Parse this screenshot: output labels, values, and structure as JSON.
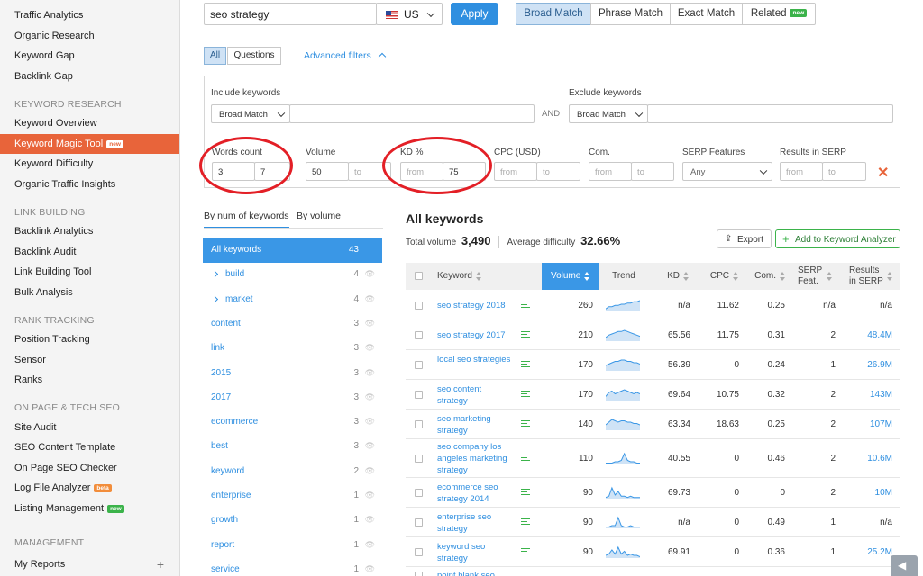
{
  "sidebar": {
    "items": [
      {
        "label": "Traffic Analytics"
      },
      {
        "label": "Organic Research"
      },
      {
        "label": "Keyword Gap"
      },
      {
        "label": "Backlink Gap"
      },
      {
        "section": "KEYWORD RESEARCH"
      },
      {
        "label": "Keyword Overview"
      },
      {
        "label": "Keyword Magic Tool",
        "badge": "new",
        "active": true
      },
      {
        "label": "Keyword Difficulty"
      },
      {
        "label": "Organic Traffic Insights"
      },
      {
        "section": "LINK BUILDING"
      },
      {
        "label": "Backlink Analytics"
      },
      {
        "label": "Backlink Audit"
      },
      {
        "label": "Link Building Tool"
      },
      {
        "label": "Bulk Analysis"
      },
      {
        "section": "RANK TRACKING"
      },
      {
        "label": "Position Tracking"
      },
      {
        "label": "Sensor"
      },
      {
        "label": "Ranks"
      },
      {
        "section": "ON PAGE & TECH SEO"
      },
      {
        "label": "Site Audit"
      },
      {
        "label": "SEO Content Template"
      },
      {
        "label": "On Page SEO Checker"
      },
      {
        "label": "Log File Analyzer",
        "badge": "beta"
      },
      {
        "label": "Listing Management",
        "badge": "new"
      },
      {
        "section": "MANAGEMENT"
      },
      {
        "label": "My Reports",
        "plus": "+"
      }
    ]
  },
  "search": {
    "value": "seo strategy",
    "country": "US",
    "apply": "Apply"
  },
  "match_tabs": [
    "Broad Match",
    "Phrase Match",
    "Exact Match",
    "Related"
  ],
  "related_badge": "new",
  "filter_tabs": {
    "all": "All",
    "questions": "Questions",
    "advanced": "Advanced filters"
  },
  "include": {
    "label": "Include keywords",
    "match": "Broad Match"
  },
  "and": "AND",
  "exclude": {
    "label": "Exclude keywords",
    "match": "Broad Match"
  },
  "filters": {
    "words": {
      "label": "Words count",
      "from": "3",
      "to": "7"
    },
    "volume": {
      "label": "Volume",
      "from": "50",
      "to_ph": "to"
    },
    "kd": {
      "label": "KD %",
      "from_ph": "from",
      "to": "75"
    },
    "cpc": {
      "label": "CPC (USD)",
      "from_ph": "from",
      "to_ph": "to"
    },
    "com": {
      "label": "Com.",
      "from_ph": "from",
      "to_ph": "to"
    },
    "serp": {
      "label": "SERP Features",
      "value": "Any"
    },
    "results": {
      "label": "Results in SERP",
      "from_ph": "from",
      "to_ph": "to"
    }
  },
  "group_tabs": {
    "by_num": "By num of keywords",
    "by_volume": "By volume"
  },
  "groups": [
    {
      "name": "All keywords",
      "count": "43",
      "active": true
    },
    {
      "name": "build",
      "count": "4",
      "expand": true
    },
    {
      "name": "market",
      "count": "4",
      "expand": true
    },
    {
      "name": "content",
      "count": "3"
    },
    {
      "name": "link",
      "count": "3"
    },
    {
      "name": "2015",
      "count": "3"
    },
    {
      "name": "2017",
      "count": "3"
    },
    {
      "name": "ecommerce",
      "count": "3"
    },
    {
      "name": "best",
      "count": "3"
    },
    {
      "name": "keyword",
      "count": "2"
    },
    {
      "name": "enterprise",
      "count": "1"
    },
    {
      "name": "growth",
      "count": "1"
    },
    {
      "name": "report",
      "count": "1"
    },
    {
      "name": "service",
      "count": "1"
    }
  ],
  "results": {
    "title": "All keywords",
    "total_label": "Total volume",
    "total_value": "3,490",
    "avg_label": "Average difficulty",
    "avg_value": "32.66%",
    "export": "Export",
    "add": "Add to Keyword Analyzer"
  },
  "columns": {
    "keyword": "Keyword",
    "volume": "Volume",
    "trend": "Trend",
    "kd": "KD",
    "cpc": "CPC",
    "com": "Com.",
    "serp": "SERP Feat.",
    "results": "Results in SERP"
  },
  "rows": [
    {
      "kw": "seo strategy 2018",
      "vol": "260",
      "kd": "n/a",
      "cpc": "11.62",
      "com": "0.25",
      "serp": "n/a",
      "res": "n/a",
      "trend": [
        2,
        4,
        4,
        5,
        5,
        6,
        6,
        7,
        7,
        8,
        8,
        9
      ]
    },
    {
      "kw": "seo strategy 2017",
      "vol": "210",
      "kd": "65.56",
      "cpc": "11.75",
      "com": "0.31",
      "serp": "2",
      "res": "48.4M",
      "trend": [
        3,
        5,
        6,
        7,
        8,
        8,
        9,
        8,
        7,
        6,
        5,
        4
      ]
    },
    {
      "kw": "local seo strategies",
      "vol": "170",
      "kd": "56.39",
      "cpc": "0",
      "com": "0.24",
      "serp": "1",
      "res": "26.9M",
      "trend": [
        4,
        5,
        6,
        7,
        7,
        8,
        8,
        7,
        7,
        6,
        6,
        5
      ]
    },
    {
      "kw": "seo content strategy",
      "vol": "170",
      "kd": "69.64",
      "cpc": "10.75",
      "com": "0.32",
      "serp": "2",
      "res": "143M",
      "trend": [
        3,
        6,
        7,
        5,
        6,
        7,
        8,
        7,
        6,
        5,
        6,
        5
      ]
    },
    {
      "kw": "seo marketing strategy",
      "vol": "140",
      "kd": "63.34",
      "cpc": "18.63",
      "com": "0.25",
      "serp": "2",
      "res": "107M",
      "trend": [
        4,
        6,
        8,
        7,
        6,
        7,
        7,
        6,
        6,
        5,
        5,
        4
      ]
    },
    {
      "kw": "seo company los angeles marketing strategy",
      "vol": "110",
      "kd": "40.55",
      "cpc": "0",
      "com": "0.46",
      "serp": "2",
      "res": "10.6M",
      "trend": [
        1,
        1,
        1,
        2,
        2,
        3,
        8,
        3,
        2,
        2,
        1,
        1
      ]
    },
    {
      "kw": "ecommerce seo strategy 2014",
      "vol": "90",
      "kd": "69.73",
      "cpc": "0",
      "com": "0",
      "serp": "2",
      "res": "10M",
      "trend": [
        1,
        2,
        9,
        3,
        6,
        2,
        2,
        1,
        2,
        1,
        1,
        1
      ]
    },
    {
      "kw": "enterprise seo strategy",
      "vol": "90",
      "kd": "n/a",
      "cpc": "0",
      "com": "0.49",
      "serp": "1",
      "res": "n/a",
      "trend": [
        1,
        1,
        2,
        2,
        8,
        2,
        1,
        1,
        2,
        1,
        1,
        1
      ]
    },
    {
      "kw": "keyword seo strategy",
      "vol": "90",
      "kd": "69.91",
      "cpc": "0",
      "com": "0.36",
      "serp": "1",
      "res": "25.2M",
      "trend": [
        2,
        3,
        6,
        3,
        8,
        3,
        5,
        2,
        3,
        2,
        2,
        1
      ]
    },
    {
      "kw": "point blank seo",
      "vol": "",
      "kd": "",
      "cpc": "",
      "com": "",
      "serp": "",
      "res": "",
      "trend": []
    }
  ]
}
